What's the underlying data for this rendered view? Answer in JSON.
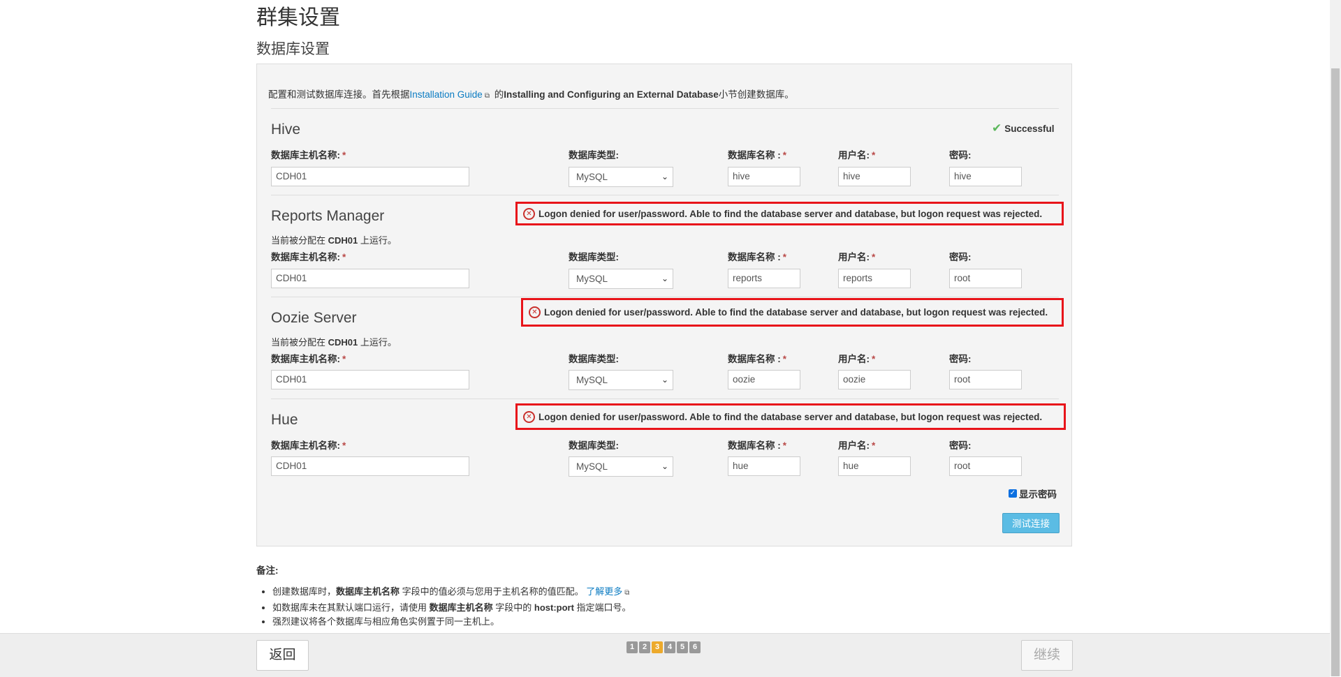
{
  "page": {
    "title": "群集设置",
    "subtitle": "数据库设置"
  },
  "intro": {
    "prefix": "配置和测试数据库连接。首先根据",
    "link": "Installation Guide",
    "middle": " 的",
    "bold": "Installing and Configuring an External Database",
    "suffix": "小节创建数据库。"
  },
  "labels": {
    "host": "数据库主机名称:",
    "type": "数据库类型:",
    "dbname": "数据库名称 :",
    "user": "用户名:",
    "password": "密码:",
    "required": "*"
  },
  "status": {
    "success": "Successful",
    "error": "Logon denied for user/password. Able to find the database server and database, but logon request was rejected."
  },
  "colors": {
    "error_border": "#e8141a",
    "success": "#5cb85c",
    "link": "#0a7bc2",
    "primary_button": "#5bbce4",
    "active_step": "#edaa2c"
  },
  "sections": [
    {
      "name": "Hive",
      "status": "success",
      "assigned": null,
      "host": "CDH01",
      "type": "MySQL",
      "dbname": "hive",
      "user": "hive",
      "password": "hive"
    },
    {
      "name": "Reports Manager",
      "status": "error",
      "assigned": {
        "prefix": "当前被分配在 ",
        "host": "CDH01",
        "suffix": " 上运行。"
      },
      "host": "CDH01",
      "type": "MySQL",
      "dbname": "reports",
      "user": "reports",
      "password": "root"
    },
    {
      "name": "Oozie Server",
      "status": "error",
      "assigned": {
        "prefix": "当前被分配在 ",
        "host": "CDH01",
        "suffix": " 上运行。"
      },
      "host": "CDH01",
      "type": "MySQL",
      "dbname": "oozie",
      "user": "oozie",
      "password": "root"
    },
    {
      "name": "Hue",
      "status": "error",
      "assigned": null,
      "host": "CDH01",
      "type": "MySQL",
      "dbname": "hue",
      "user": "hue",
      "password": "root"
    }
  ],
  "show_password": {
    "label": "显示密码",
    "checked": true
  },
  "test_button": "测试连接",
  "notes": {
    "title": "备注:",
    "items": [
      {
        "a": "创建数据库时，",
        "b": "数据库主机名称",
        "c": " 字段中的值必须与您用于主机名称的值匹配。 ",
        "link": "了解更多"
      },
      {
        "a": "如数据库未在其默认端口运行，请使用 ",
        "b": "数据库主机名称",
        "c": " 字段中的 ",
        "d": "host:port",
        "e": " 指定端口号。"
      },
      {
        "a": "强烈建议将各个数据库与相应角色实例置于同一主机上。"
      }
    ]
  },
  "footer": {
    "back": "返回",
    "continue": "继续",
    "steps": [
      "1",
      "2",
      "3",
      "4",
      "5",
      "6"
    ],
    "current_step": 3
  }
}
